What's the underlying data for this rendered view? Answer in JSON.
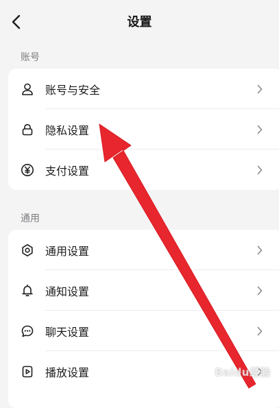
{
  "header": {
    "back_icon": "chevron-left-icon",
    "title": "设置"
  },
  "sections": [
    {
      "label": "账号",
      "items": [
        {
          "label": "账号与安全",
          "icon": "user-icon"
        },
        {
          "label": "隐私设置",
          "icon": "lock-icon"
        },
        {
          "label": "支付设置",
          "icon": "yen-circle-icon"
        }
      ]
    },
    {
      "label": "通用",
      "items": [
        {
          "label": "通用设置",
          "icon": "gear-icon"
        },
        {
          "label": "通知设置",
          "icon": "bell-icon"
        },
        {
          "label": "聊天设置",
          "icon": "chat-bubble-icon"
        },
        {
          "label": "播放设置",
          "icon": "play-icon"
        }
      ]
    }
  ],
  "colors": {
    "background": "#f4f4f5",
    "card": "#ffffff",
    "annotation_arrow": "#e8262d"
  },
  "watermark": "Baidu经验"
}
